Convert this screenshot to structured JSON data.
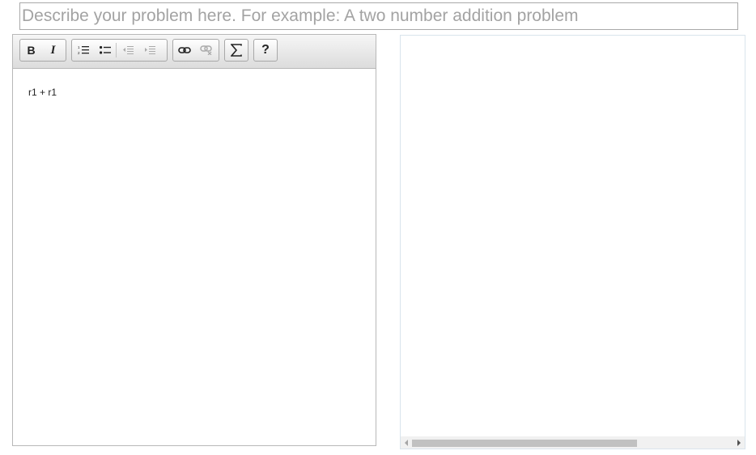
{
  "problem_field": {
    "placeholder": "Describe your problem here. For example: A two number addition problem",
    "value": ""
  },
  "editor": {
    "toolbar": {
      "bold_label": "B",
      "italic_label": "I",
      "help_label": "?"
    },
    "content": "r1 + r1"
  },
  "icons": {
    "bold": "bold-icon",
    "italic": "italic-icon",
    "numbered_list": "numbered-list-icon",
    "bulleted_list": "bulleted-list-icon",
    "decrease_indent": "outdent-icon",
    "increase_indent": "indent-icon",
    "link": "link-icon",
    "unlink": "unlink-icon",
    "math": "sigma-icon",
    "help": "help-icon"
  },
  "colors": {
    "placeholder": "#a3a3a3",
    "toolbar_top": "#f6f6f6",
    "toolbar_bottom": "#dcdcdc",
    "scroll_thumb": "#c1c1c1"
  }
}
